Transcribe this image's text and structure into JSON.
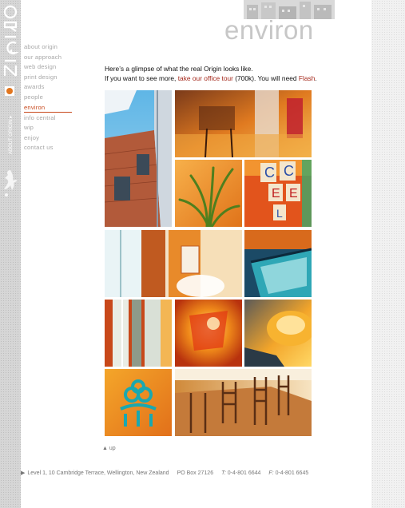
{
  "brand": {
    "logo_text": "ORIGIN",
    "side_tag": "ABOUT ORIGIN"
  },
  "nav": {
    "items": [
      {
        "label": "about origin",
        "active": false
      },
      {
        "label": "our approach",
        "active": false
      },
      {
        "label": "web design",
        "active": false
      },
      {
        "label": "print design",
        "active": false
      },
      {
        "label": "awards",
        "active": false
      },
      {
        "label": "people",
        "active": false
      },
      {
        "label": "environ",
        "active": true
      },
      {
        "label": "info central",
        "active": false
      },
      {
        "label": "wip",
        "active": false
      },
      {
        "label": "enjoy",
        "active": false
      },
      {
        "label": "contact us",
        "active": false
      }
    ]
  },
  "header": {
    "section_title": "environ"
  },
  "intro": {
    "line1": "Here’s a glimpse of what the real Origin looks like.",
    "line2_before": "If you want to see more, ",
    "tour_link": "take our office tour",
    "line2_middle": " (700k). You will need ",
    "flash_link": "Flash",
    "line2_after": "."
  },
  "gallery": {
    "photos": [
      "building-photo",
      "chairs-photo",
      "plant-photo",
      "letter-blocks-photo",
      "window-chair-photo",
      "monitor-photo",
      "glass-photo",
      "orange-lamp-photo",
      "yellow-light-photo",
      "ornament-photo",
      "meeting-table-photo"
    ]
  },
  "footer": {
    "up_label": "up",
    "address": "Level 1, 10 Cambridge Terrace, Wellington, New Zealand",
    "po_box": "PO Box 27126",
    "phone_label": "T:",
    "phone": "0-4-801 6644",
    "fax_label": "F:",
    "fax": "0-4-801 6645"
  },
  "colors": {
    "accent": "#c84a1e",
    "link": "#a4271a",
    "nav_text": "#a8a8a8",
    "title_grey": "#c7c7c7"
  }
}
